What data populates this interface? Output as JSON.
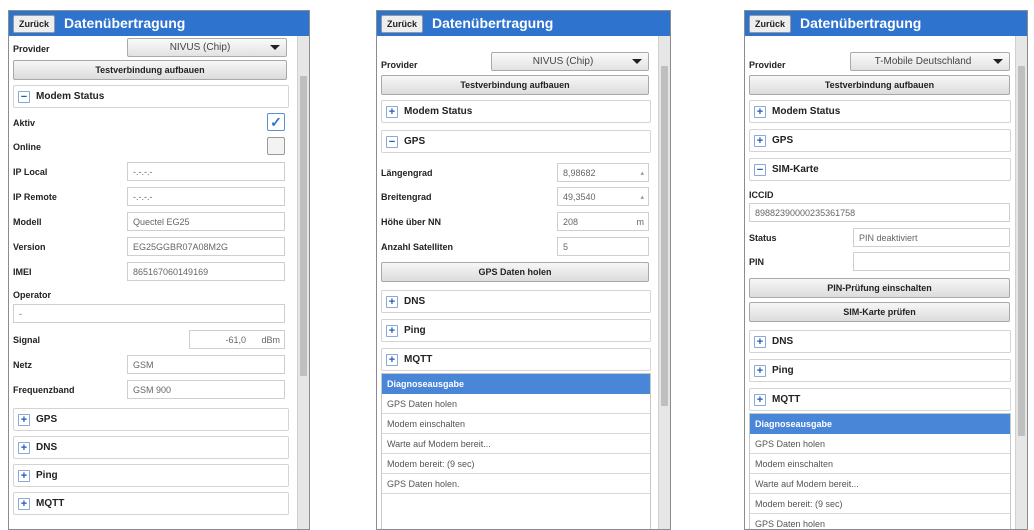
{
  "common": {
    "back_label": "Zurück",
    "title": "Datenübertragung",
    "provider_label": "Provider",
    "test_connection": "Testverbindung aufbauen"
  },
  "panel1": {
    "provider_value": "NIVUS (Chip)",
    "modem_section": "Modem Status",
    "aktiv_label": "Aktiv",
    "online_label": "Online",
    "aktiv_checked": true,
    "online_checked": false,
    "ip_local_label": "IP Local",
    "ip_local_value": "-.-.-.-",
    "ip_remote_label": "IP Remote",
    "ip_remote_value": "-.-.-.-",
    "modell_label": "Modell",
    "modell_value": "Quectel EG25",
    "version_label": "Version",
    "version_value": "EG25GGBR07A08M2G",
    "imei_label": "IMEI",
    "imei_value": "865167060149169",
    "operator_label": "Operator",
    "operator_value": "-",
    "signal_label": "Signal",
    "signal_value": "-61,0",
    "signal_unit": "dBm",
    "netz_label": "Netz",
    "netz_value": "GSM",
    "freq_label": "Frequenzband",
    "freq_value": "GSM 900",
    "gps_section": "GPS",
    "dns_section": "DNS",
    "ping_section": "Ping",
    "mqtt_section": "MQTT"
  },
  "panel2": {
    "provider_value": "NIVUS (Chip)",
    "modem_section": "Modem Status",
    "gps_section": "GPS",
    "laengengrad_label": "Längengrad",
    "laengengrad_value": "8,98682",
    "breitengrad_label": "Breitengrad",
    "breitengrad_value": "49,3540",
    "hoehe_label": "Höhe über NN",
    "hoehe_value": "208",
    "hoehe_unit": "m",
    "satelliten_label": "Anzahl Satelliten",
    "satelliten_value": "5",
    "gps_button": "GPS Daten holen",
    "dns_section": "DNS",
    "ping_section": "Ping",
    "mqtt_section": "MQTT",
    "diag_header": "Diagnoseausgabe",
    "diag_rows": [
      "GPS Daten holen",
      "Modem einschalten",
      "Warte auf Modem bereit...",
      "Modem bereit: (9 sec)",
      "GPS Daten holen."
    ]
  },
  "panel3": {
    "provider_value": "T-Mobile Deutschland",
    "modem_section": "Modem Status",
    "gps_section": "GPS",
    "sim_section": "SIM-Karte",
    "iccid_label": "ICCID",
    "iccid_value": "89882390000235361758",
    "status_label": "Status",
    "status_value": "PIN deaktiviert",
    "pin_label": "PIN",
    "pin_value": "",
    "pin_button": "PIN-Prüfung einschalten",
    "sim_button": "SIM-Karte prüfen",
    "dns_section": "DNS",
    "ping_section": "Ping",
    "mqtt_section": "MQTT",
    "diag_header": "Diagnoseausgabe",
    "diag_rows": [
      "GPS Daten holen",
      "Modem einschalten",
      "Warte auf Modem bereit...",
      "Modem bereit: (9 sec)",
      "GPS Daten holen"
    ]
  }
}
